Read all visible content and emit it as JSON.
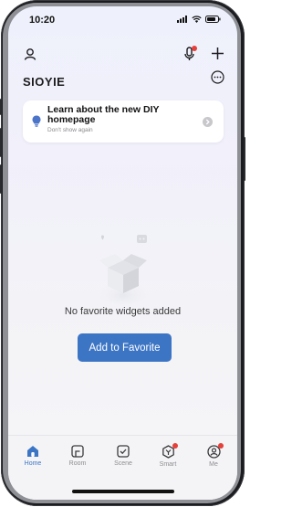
{
  "status_bar": {
    "time": "10:20"
  },
  "header": {
    "brand": "SIOYIE",
    "icons": [
      "user-icon",
      "microphone-icon",
      "plus-icon",
      "more-icon"
    ]
  },
  "banner": {
    "title": "Learn about the new DIY homepage",
    "subtitle": "Don't show again",
    "icon": "lightbulb-icon"
  },
  "empty_state": {
    "message": "No favorite widgets added",
    "button_label": "Add to Favorite"
  },
  "tabs": [
    {
      "label": "Home",
      "icon": "home-icon",
      "active": true
    },
    {
      "label": "Room",
      "icon": "room-icon",
      "active": false
    },
    {
      "label": "Scene",
      "icon": "scene-icon",
      "active": false
    },
    {
      "label": "Smart",
      "icon": "smart-icon",
      "active": false,
      "badge": true
    },
    {
      "label": "Me",
      "icon": "me-icon",
      "active": false,
      "badge": true
    }
  ],
  "colors": {
    "accent": "#3d75c5",
    "badge": "#e5403a"
  }
}
